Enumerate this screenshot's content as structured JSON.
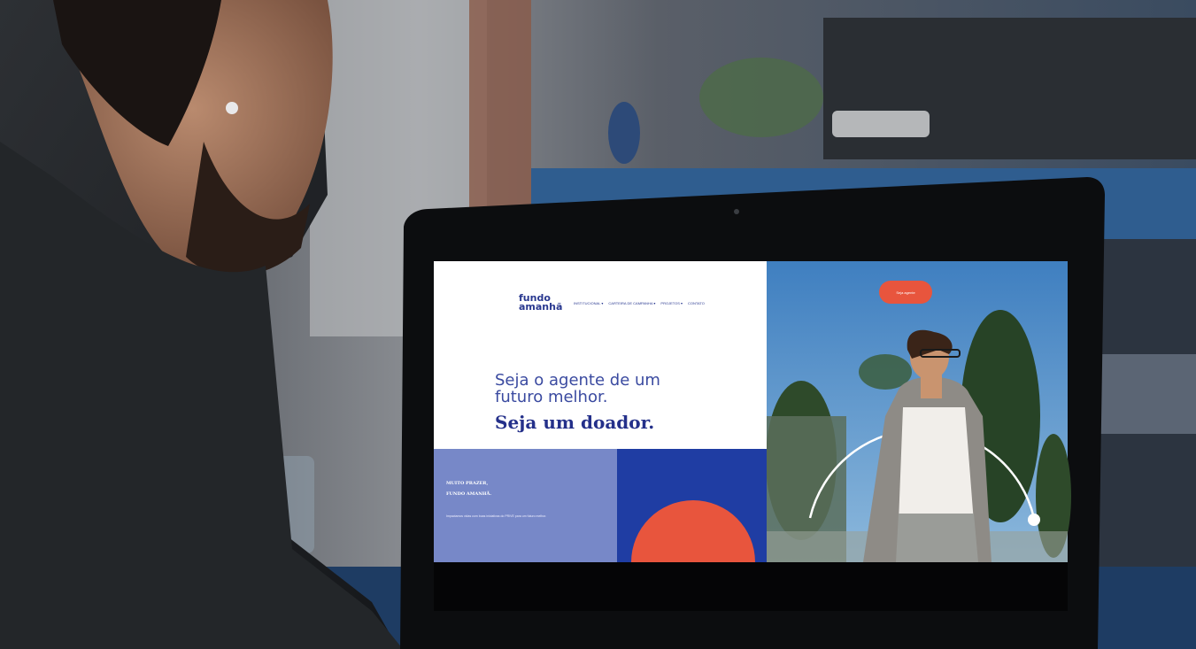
{
  "site": {
    "logo": {
      "line1": "fundo",
      "line2": "amanhã"
    },
    "nav": [
      "INSTITUCIONAL ▾",
      "CARTEIRA DE CAMPANHA ▾",
      "PROJETOS ▾",
      "CONTATO"
    ],
    "hero": {
      "line1": "Seja o agente de um",
      "line2": "futuro melhor.",
      "strong": "Seja um doador."
    },
    "band": {
      "title_line1": "MUITO PRAZER,",
      "title_line2": "FUNDO AMANHÃ.",
      "text": "Impactamos vidas com boas iniciativas do PRIVE para um futuro melhor."
    },
    "donor_button": "Seja agente",
    "colors": {
      "brand_blue": "#2a3990",
      "accent_orange": "#e8553d",
      "band_periwinkle": "#7788c8",
      "band_blue": "#1f3da3"
    }
  }
}
